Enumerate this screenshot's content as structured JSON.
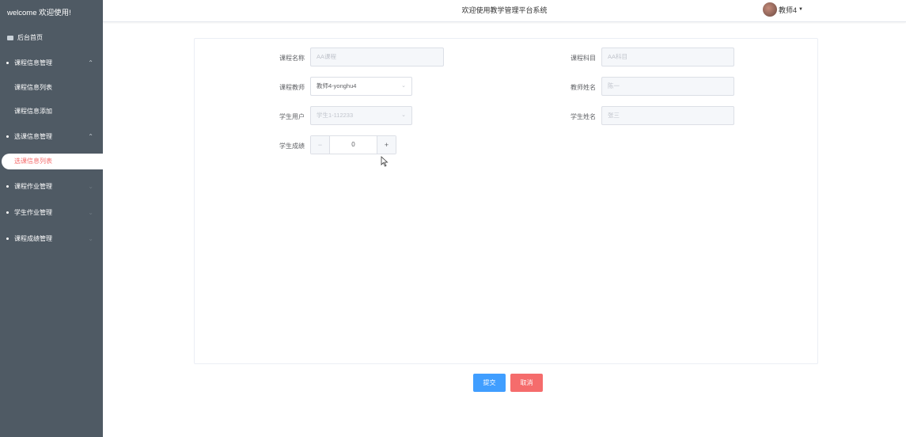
{
  "sidebar": {
    "welcome": "welcome 欢迎使用!",
    "home": "后台首页",
    "groups": [
      {
        "label": "课程信息管理",
        "expanded": true,
        "items": [
          "课程信息列表",
          "课程信息添加"
        ]
      },
      {
        "label": "选课信息管理",
        "expanded": true,
        "items": [
          "选课信息列表"
        ],
        "active_item": "选课信息列表"
      },
      {
        "label": "课程作业管理",
        "expanded": false
      },
      {
        "label": "学生作业管理",
        "expanded": false
      },
      {
        "label": "课程成绩管理",
        "expanded": false
      }
    ]
  },
  "header": {
    "title": "欢迎使用教学管理平台系统",
    "user": "教师4"
  },
  "form": {
    "course_name": {
      "label": "课程名称",
      "value": "AA课程"
    },
    "course_subject": {
      "label": "课程科目",
      "value": "AA科目"
    },
    "course_teacher": {
      "label": "课程教师",
      "value": "教师4-yonghu4"
    },
    "teacher_name": {
      "label": "教师姓名",
      "value": "陈一"
    },
    "student_user": {
      "label": "学生用户",
      "value": "学生1-112233"
    },
    "student_name": {
      "label": "学生姓名",
      "value": "张三"
    },
    "student_score": {
      "label": "学生成绩",
      "value": "0",
      "minus": "−",
      "plus": "+"
    }
  },
  "buttons": {
    "submit": "提交",
    "cancel": "取消"
  },
  "colors": {
    "sidebar_bg": "#4f5a64",
    "primary": "#409eff",
    "danger": "#f56c6c"
  }
}
